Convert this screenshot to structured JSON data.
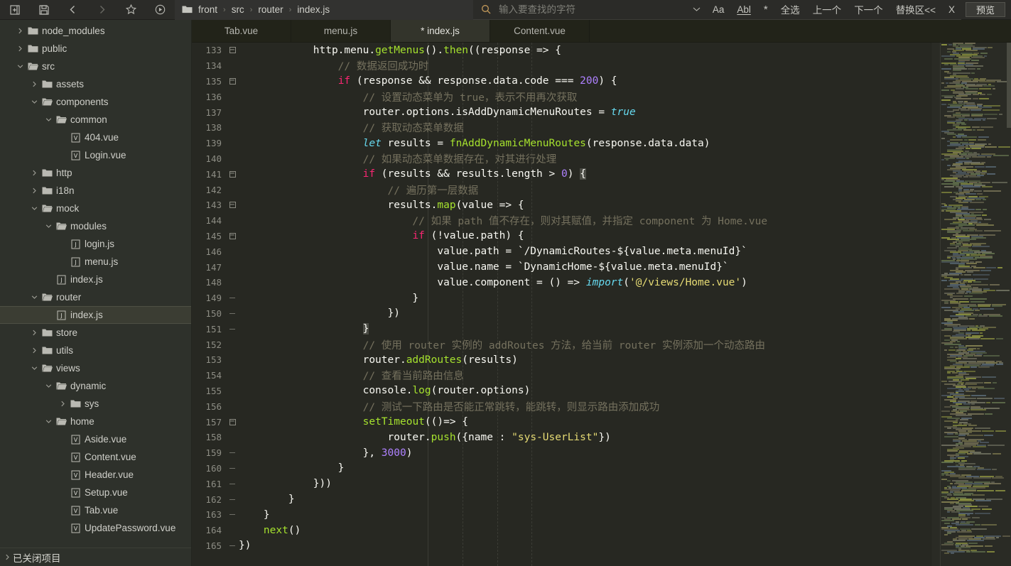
{
  "toolbar": {
    "buttons": [
      {
        "name": "new-file-icon",
        "title": "新建"
      },
      {
        "name": "save-icon",
        "title": "保存"
      },
      {
        "name": "back-arrow-icon",
        "title": "后退"
      },
      {
        "name": "forward-arrow-icon",
        "title": "前进"
      },
      {
        "name": "star-icon",
        "title": "收藏"
      },
      {
        "name": "run-icon",
        "title": "运行"
      }
    ],
    "breadcrumb": [
      "front",
      "src",
      "router",
      "index.js"
    ],
    "breadcrumb_separator": "›",
    "search": {
      "placeholder": "输入要查找的字符",
      "value": "",
      "icon": "search-icon",
      "dropdown_icon": "chevron-down-icon"
    },
    "search_options": [
      {
        "label": "Aa",
        "name": "match-case-toggle"
      },
      {
        "label": "Abl",
        "name": "whole-word-toggle"
      },
      {
        "label": "*",
        "name": "regex-toggle"
      }
    ],
    "search_actions": [
      {
        "label": "全选",
        "name": "select-all-button"
      },
      {
        "label": "上一个",
        "name": "find-previous-button"
      },
      {
        "label": "下一个",
        "name": "find-next-button"
      },
      {
        "label": "替换区<<",
        "name": "toggle-replace-button"
      },
      {
        "label": "X",
        "name": "close-search-button"
      }
    ],
    "preview_label": "预览"
  },
  "sidebar": {
    "footer_label": "已关闭项目",
    "tree": [
      {
        "label": "node_modules",
        "depth": 0,
        "type": "folder",
        "state": "collapsed"
      },
      {
        "label": "public",
        "depth": 0,
        "type": "folder",
        "state": "collapsed"
      },
      {
        "label": "src",
        "depth": 0,
        "type": "folder",
        "state": "expanded"
      },
      {
        "label": "assets",
        "depth": 1,
        "type": "folder",
        "state": "collapsed"
      },
      {
        "label": "components",
        "depth": 1,
        "type": "folder",
        "state": "expanded"
      },
      {
        "label": "common",
        "depth": 2,
        "type": "folder",
        "state": "expanded"
      },
      {
        "label": "404.vue",
        "depth": 3,
        "type": "vue",
        "state": "none"
      },
      {
        "label": "Login.vue",
        "depth": 3,
        "type": "vue",
        "state": "none"
      },
      {
        "label": "http",
        "depth": 1,
        "type": "folder",
        "state": "collapsed"
      },
      {
        "label": "i18n",
        "depth": 1,
        "type": "folder",
        "state": "collapsed"
      },
      {
        "label": "mock",
        "depth": 1,
        "type": "folder",
        "state": "expanded"
      },
      {
        "label": "modules",
        "depth": 2,
        "type": "folder",
        "state": "expanded"
      },
      {
        "label": "login.js",
        "depth": 3,
        "type": "js",
        "state": "none"
      },
      {
        "label": "menu.js",
        "depth": 3,
        "type": "js",
        "state": "none"
      },
      {
        "label": "index.js",
        "depth": 2,
        "type": "js",
        "state": "none"
      },
      {
        "label": "router",
        "depth": 1,
        "type": "folder",
        "state": "expanded"
      },
      {
        "label": "index.js",
        "depth": 2,
        "type": "js",
        "state": "none",
        "selected": true
      },
      {
        "label": "store",
        "depth": 1,
        "type": "folder",
        "state": "collapsed"
      },
      {
        "label": "utils",
        "depth": 1,
        "type": "folder",
        "state": "collapsed"
      },
      {
        "label": "views",
        "depth": 1,
        "type": "folder",
        "state": "expanded"
      },
      {
        "label": "dynamic",
        "depth": 2,
        "type": "folder",
        "state": "expanded"
      },
      {
        "label": "sys",
        "depth": 3,
        "type": "folder",
        "state": "collapsed"
      },
      {
        "label": "home",
        "depth": 2,
        "type": "folder",
        "state": "expanded"
      },
      {
        "label": "Aside.vue",
        "depth": 3,
        "type": "vue",
        "state": "none"
      },
      {
        "label": "Content.vue",
        "depth": 3,
        "type": "vue",
        "state": "none"
      },
      {
        "label": "Header.vue",
        "depth": 3,
        "type": "vue",
        "state": "none"
      },
      {
        "label": "Setup.vue",
        "depth": 3,
        "type": "vue",
        "state": "none"
      },
      {
        "label": "Tab.vue",
        "depth": 3,
        "type": "vue",
        "state": "none"
      },
      {
        "label": "UpdatePassword.vue",
        "depth": 3,
        "type": "vue",
        "state": "none"
      }
    ]
  },
  "tabs": [
    {
      "label": "Tab.vue",
      "active": false
    },
    {
      "label": "menu.js",
      "active": false
    },
    {
      "label": "* index.js",
      "active": true
    },
    {
      "label": "Content.vue",
      "active": false
    }
  ],
  "editor": {
    "first_line": 133,
    "last_line": 165,
    "lines": [
      {
        "n": 133,
        "fold": "open",
        "tokens": [
          {
            "t": "plain",
            "v": "            http.menu."
          },
          {
            "t": "fn",
            "v": "getMenus"
          },
          {
            "t": "plain",
            "v": "()."
          },
          {
            "t": "fn",
            "v": "then"
          },
          {
            "t": "plain",
            "v": "((response => {"
          }
        ]
      },
      {
        "n": 134,
        "fold": "",
        "tokens": [
          {
            "t": "cmt",
            "v": "                // 数据返回成功时"
          }
        ]
      },
      {
        "n": 135,
        "fold": "open",
        "tokens": [
          {
            "t": "plain",
            "v": "                "
          },
          {
            "t": "kw",
            "v": "if"
          },
          {
            "t": "plain",
            "v": " (response && response.data.code === "
          },
          {
            "t": "num",
            "v": "200"
          },
          {
            "t": "plain",
            "v": ") {"
          }
        ]
      },
      {
        "n": 136,
        "fold": "",
        "tokens": [
          {
            "t": "cmt",
            "v": "                    // 设置动态菜单为 true，表示不用再次获取"
          }
        ]
      },
      {
        "n": 137,
        "fold": "",
        "tokens": [
          {
            "t": "plain",
            "v": "                    router.options.isAddDynamicMenuRoutes = "
          },
          {
            "t": "kw2",
            "v": "true"
          }
        ]
      },
      {
        "n": 138,
        "fold": "",
        "tokens": [
          {
            "t": "cmt",
            "v": "                    // 获取动态菜单数据"
          }
        ]
      },
      {
        "n": 139,
        "fold": "",
        "tokens": [
          {
            "t": "plain",
            "v": "                    "
          },
          {
            "t": "kw2",
            "v": "let"
          },
          {
            "t": "plain",
            "v": " results = "
          },
          {
            "t": "fn",
            "v": "fnAddDynamicMenuRoutes"
          },
          {
            "t": "plain",
            "v": "(response.data.data)"
          }
        ]
      },
      {
        "n": 140,
        "fold": "",
        "tokens": [
          {
            "t": "cmt",
            "v": "                    // 如果动态菜单数据存在，对其进行处理"
          }
        ]
      },
      {
        "n": 141,
        "fold": "open",
        "tokens": [
          {
            "t": "plain",
            "v": "                    "
          },
          {
            "t": "kw",
            "v": "if"
          },
          {
            "t": "plain",
            "v": " (results && results.length > "
          },
          {
            "t": "num",
            "v": "0"
          },
          {
            "t": "plain",
            "v": ") "
          },
          {
            "t": "caret",
            "v": "{"
          }
        ]
      },
      {
        "n": 142,
        "fold": "",
        "tokens": [
          {
            "t": "cmt",
            "v": "                        // 遍历第一层数据"
          }
        ]
      },
      {
        "n": 143,
        "fold": "open",
        "tokens": [
          {
            "t": "plain",
            "v": "                        results."
          },
          {
            "t": "fn",
            "v": "map"
          },
          {
            "t": "plain",
            "v": "(value => {"
          }
        ]
      },
      {
        "n": 144,
        "fold": "",
        "tokens": [
          {
            "t": "cmt",
            "v": "                            // 如果 path 值不存在，则对其赋值，并指定 component 为 Home.vue"
          }
        ]
      },
      {
        "n": 145,
        "fold": "open",
        "tokens": [
          {
            "t": "plain",
            "v": "                            "
          },
          {
            "t": "kw",
            "v": "if"
          },
          {
            "t": "plain",
            "v": " (!value.path) {"
          }
        ]
      },
      {
        "n": 146,
        "fold": "",
        "tokens": [
          {
            "t": "plain",
            "v": "                                value.path = `/DynamicRoutes-${value.meta.menuId}`"
          }
        ]
      },
      {
        "n": 147,
        "fold": "",
        "tokens": [
          {
            "t": "plain",
            "v": "                                value.name = `DynamicHome-${value.meta.menuId}`"
          }
        ]
      },
      {
        "n": 148,
        "fold": "",
        "tokens": [
          {
            "t": "plain",
            "v": "                                value.component = () => "
          },
          {
            "t": "kw2",
            "v": "import"
          },
          {
            "t": "plain",
            "v": "("
          },
          {
            "t": "str",
            "v": "'@/views/Home.vue'"
          },
          {
            "t": "plain",
            "v": ")"
          }
        ]
      },
      {
        "n": 149,
        "fold": "end",
        "tokens": [
          {
            "t": "plain",
            "v": "                            }"
          }
        ]
      },
      {
        "n": 150,
        "fold": "end",
        "tokens": [
          {
            "t": "plain",
            "v": "                        })"
          }
        ]
      },
      {
        "n": 151,
        "fold": "end",
        "tokens": [
          {
            "t": "plain",
            "v": "                    "
          },
          {
            "t": "caret",
            "v": "}"
          }
        ]
      },
      {
        "n": 152,
        "fold": "",
        "tokens": [
          {
            "t": "cmt",
            "v": "                    // 使用 router 实例的 addRoutes 方法，给当前 router 实例添加一个动态路由"
          }
        ]
      },
      {
        "n": 153,
        "fold": "",
        "tokens": [
          {
            "t": "plain",
            "v": "                    router."
          },
          {
            "t": "fn",
            "v": "addRoutes"
          },
          {
            "t": "plain",
            "v": "(results)"
          }
        ]
      },
      {
        "n": 154,
        "fold": "",
        "tokens": [
          {
            "t": "cmt",
            "v": "                    // 查看当前路由信息"
          }
        ]
      },
      {
        "n": 155,
        "fold": "",
        "tokens": [
          {
            "t": "plain",
            "v": "                    console."
          },
          {
            "t": "fn",
            "v": "log"
          },
          {
            "t": "plain",
            "v": "(router.options)"
          }
        ]
      },
      {
        "n": 156,
        "fold": "",
        "tokens": [
          {
            "t": "cmt",
            "v": "                    // 测试一下路由是否能正常跳转，能跳转，则显示路由添加成功"
          }
        ]
      },
      {
        "n": 157,
        "fold": "open",
        "tokens": [
          {
            "t": "plain",
            "v": "                    "
          },
          {
            "t": "fn",
            "v": "setTimeout"
          },
          {
            "t": "plain",
            "v": "(()=> {"
          }
        ]
      },
      {
        "n": 158,
        "fold": "",
        "tokens": [
          {
            "t": "plain",
            "v": "                        router."
          },
          {
            "t": "fn",
            "v": "push"
          },
          {
            "t": "plain",
            "v": "({name : "
          },
          {
            "t": "str",
            "v": "\"sys-UserList\""
          },
          {
            "t": "plain",
            "v": "})"
          }
        ]
      },
      {
        "n": 159,
        "fold": "end",
        "tokens": [
          {
            "t": "plain",
            "v": "                    }, "
          },
          {
            "t": "num",
            "v": "3000"
          },
          {
            "t": "plain",
            "v": ")"
          }
        ]
      },
      {
        "n": 160,
        "fold": "end",
        "tokens": [
          {
            "t": "plain",
            "v": "                }"
          }
        ]
      },
      {
        "n": 161,
        "fold": "end",
        "tokens": [
          {
            "t": "plain",
            "v": "            }))"
          }
        ]
      },
      {
        "n": 162,
        "fold": "end",
        "tokens": [
          {
            "t": "plain",
            "v": "        }"
          }
        ]
      },
      {
        "n": 163,
        "fold": "end",
        "tokens": [
          {
            "t": "plain",
            "v": "    }"
          }
        ]
      },
      {
        "n": 164,
        "fold": "",
        "tokens": [
          {
            "t": "plain",
            "v": "    "
          },
          {
            "t": "fn",
            "v": "next"
          },
          {
            "t": "plain",
            "v": "()"
          }
        ]
      },
      {
        "n": 165,
        "fold": "end",
        "tokens": [
          {
            "t": "plain",
            "v": "})"
          }
        ]
      }
    ]
  },
  "colors": {
    "background": "#272822",
    "sidebar_bg": "#2e312b",
    "toolbar_bg": "#2b2b28",
    "tabbar_bg": "#222319",
    "active_tab_bg": "#33342b",
    "keyword": "#f92672",
    "function": "#a6e22e",
    "number": "#ae81ff",
    "string": "#e6db74",
    "comment": "#75715e",
    "plain_text": "#f8f8f2",
    "type_keyword": "#66d9ef"
  },
  "minimap": {
    "label": "code-minimap"
  }
}
